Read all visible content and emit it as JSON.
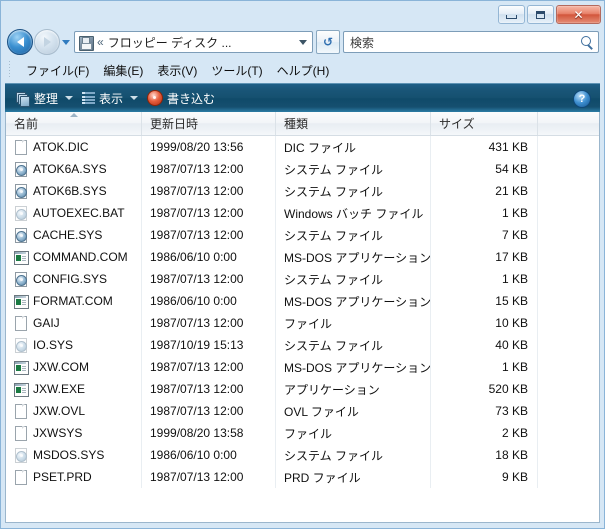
{
  "window": {
    "controls": {
      "minimize_label": "–",
      "maximize_label": "□",
      "close_label": "✕"
    }
  },
  "nav": {
    "back_tooltip": "戻る",
    "forward_tooltip": "進む",
    "history_caret": "▾",
    "breadcrumb_chevron": "«",
    "breadcrumb": "フロッピー ディスク ...",
    "address_caret": "▾",
    "refresh_label": "↺",
    "drive_icon": "floppy-disk-icon"
  },
  "search": {
    "placeholder": "検索",
    "value": "検索",
    "icon": "search-icon"
  },
  "menu": {
    "items": [
      {
        "label": "ファイル(F)"
      },
      {
        "label": "編集(E)"
      },
      {
        "label": "表示(V)"
      },
      {
        "label": "ツール(T)"
      },
      {
        "label": "ヘルプ(H)"
      }
    ]
  },
  "toolbar": {
    "organize_label": "整理",
    "views_label": "表示",
    "burn_label": "書き込む",
    "caret": "▾",
    "help_label": "?",
    "background_color": "#15506f"
  },
  "columns": [
    {
      "key": "name",
      "label": "名前",
      "sorted": "asc"
    },
    {
      "key": "date",
      "label": "更新日時",
      "sorted": ""
    },
    {
      "key": "type",
      "label": "種類",
      "sorted": ""
    },
    {
      "key": "size",
      "label": "サイズ",
      "sorted": ""
    }
  ],
  "files": [
    {
      "name": "ATOK.DIC",
      "date": "1999/08/20 13:56",
      "type": "DIC ファイル",
      "size": "431 KB",
      "icon": "document-icon"
    },
    {
      "name": "ATOK6A.SYS",
      "date": "1987/07/13 12:00",
      "type": "システム ファイル",
      "size": "54 KB",
      "icon": "system-file-icon"
    },
    {
      "name": "ATOK6B.SYS",
      "date": "1987/07/13 12:00",
      "type": "システム ファイル",
      "size": "21 KB",
      "icon": "system-file-icon"
    },
    {
      "name": "AUTOEXEC.BAT",
      "date": "1987/07/13 12:00",
      "type": "Windows バッチ ファイル",
      "size": "1 KB",
      "icon": "system-file-icon-hidden"
    },
    {
      "name": "CACHE.SYS",
      "date": "1987/07/13 12:00",
      "type": "システム ファイル",
      "size": "7 KB",
      "icon": "system-file-icon"
    },
    {
      "name": "COMMAND.COM",
      "date": "1986/06/10 0:00",
      "type": "MS-DOS アプリケーション",
      "size": "17 KB",
      "icon": "msdos-application-icon"
    },
    {
      "name": "CONFIG.SYS",
      "date": "1987/07/13 12:00",
      "type": "システム ファイル",
      "size": "1 KB",
      "icon": "system-file-icon"
    },
    {
      "name": "FORMAT.COM",
      "date": "1986/06/10 0:00",
      "type": "MS-DOS アプリケーション",
      "size": "15 KB",
      "icon": "msdos-application-icon"
    },
    {
      "name": "GAIJ",
      "date": "1987/07/13 12:00",
      "type": "ファイル",
      "size": "10 KB",
      "icon": "document-icon"
    },
    {
      "name": "IO.SYS",
      "date": "1987/10/19 15:13",
      "type": "システム ファイル",
      "size": "40 KB",
      "icon": "system-file-icon-hidden"
    },
    {
      "name": "JXW.COM",
      "date": "1987/07/13 12:00",
      "type": "MS-DOS アプリケーション",
      "size": "1 KB",
      "icon": "msdos-application-icon"
    },
    {
      "name": "JXW.EXE",
      "date": "1987/07/13 12:00",
      "type": "アプリケーション",
      "size": "520 KB",
      "icon": "msdos-application-icon"
    },
    {
      "name": "JXW.OVL",
      "date": "1987/07/13 12:00",
      "type": "OVL ファイル",
      "size": "73 KB",
      "icon": "document-icon"
    },
    {
      "name": "JXWSYS",
      "date": "1999/08/20 13:58",
      "type": "ファイル",
      "size": "2 KB",
      "icon": "document-icon"
    },
    {
      "name": "MSDOS.SYS",
      "date": "1986/06/10 0:00",
      "type": "システム ファイル",
      "size": "18 KB",
      "icon": "system-file-icon-hidden"
    },
    {
      "name": "PSET.PRD",
      "date": "1987/07/13 12:00",
      "type": "PRD ファイル",
      "size": "9 KB",
      "icon": "document-icon"
    }
  ]
}
